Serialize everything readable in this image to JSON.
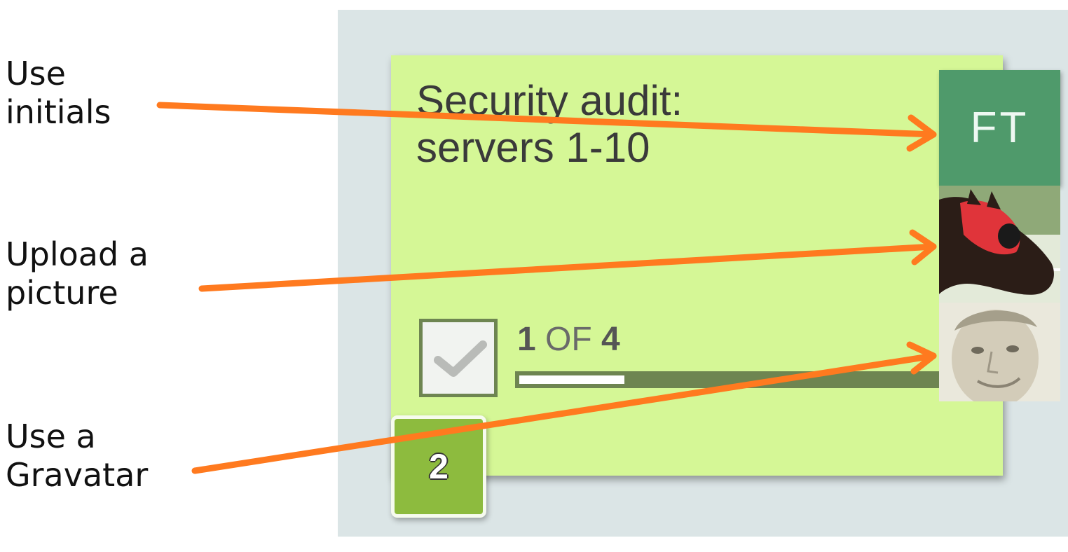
{
  "labels": {
    "initials": "Use\ninitials",
    "upload": "Upload a\npicture",
    "gravatar": "Use a\nGravatar"
  },
  "card": {
    "title": "Security audit:\nservers 1-10",
    "progress": {
      "done": "1",
      "of": "OF",
      "total": "4",
      "fraction": 0.25
    },
    "badge_count": "2"
  },
  "avatars": {
    "initials": "FT",
    "picture_icon": "horse-photo",
    "gravatar_icon": "face-photo"
  },
  "colors": {
    "arrow": "#ff7a1f",
    "card": "#d5f796",
    "board": "#dbe5e6",
    "initials_bg": "#4f9a6b",
    "badge": "#8dbb3e",
    "progress_track": "#6e8551"
  }
}
